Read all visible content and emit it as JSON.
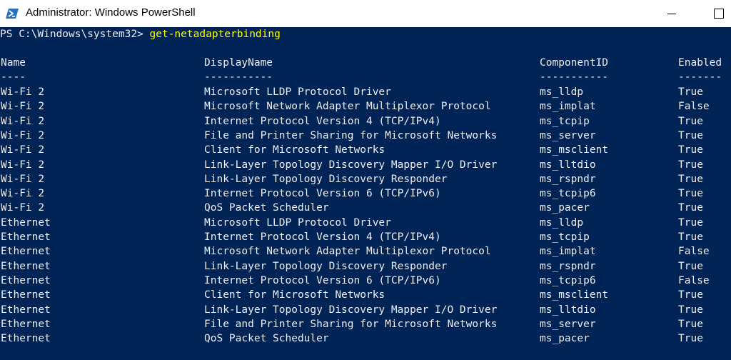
{
  "window": {
    "title": "Administrator: Windows PowerShell"
  },
  "console": {
    "prompt": "PS C:\\Windows\\system32> ",
    "command": "get-netadapterbinding",
    "headers": {
      "name": "Name",
      "display_name": "DisplayName",
      "component_id": "ComponentID",
      "enabled": "Enabled"
    },
    "underlines": {
      "name": "----",
      "display_name": "-----------",
      "component_id": "-----------",
      "enabled": "-------"
    },
    "rows": [
      {
        "name": "Wi-Fi 2",
        "display_name": "Microsoft LLDP Protocol Driver",
        "component_id": "ms_lldp",
        "enabled": "True"
      },
      {
        "name": "Wi-Fi 2",
        "display_name": "Microsoft Network Adapter Multiplexor Protocol",
        "component_id": "ms_implat",
        "enabled": "False"
      },
      {
        "name": "Wi-Fi 2",
        "display_name": "Internet Protocol Version 4 (TCP/IPv4)",
        "component_id": "ms_tcpip",
        "enabled": "True"
      },
      {
        "name": "Wi-Fi 2",
        "display_name": "File and Printer Sharing for Microsoft Networks",
        "component_id": "ms_server",
        "enabled": "True"
      },
      {
        "name": "Wi-Fi 2",
        "display_name": "Client for Microsoft Networks",
        "component_id": "ms_msclient",
        "enabled": "True"
      },
      {
        "name": "Wi-Fi 2",
        "display_name": "Link-Layer Topology Discovery Mapper I/O Driver",
        "component_id": "ms_lltdio",
        "enabled": "True"
      },
      {
        "name": "Wi-Fi 2",
        "display_name": "Link-Layer Topology Discovery Responder",
        "component_id": "ms_rspndr",
        "enabled": "True"
      },
      {
        "name": "Wi-Fi 2",
        "display_name": "Internet Protocol Version 6 (TCP/IPv6)",
        "component_id": "ms_tcpip6",
        "enabled": "True"
      },
      {
        "name": "Wi-Fi 2",
        "display_name": "QoS Packet Scheduler",
        "component_id": "ms_pacer",
        "enabled": "True"
      },
      {
        "name": "Ethernet",
        "display_name": "Microsoft LLDP Protocol Driver",
        "component_id": "ms_lldp",
        "enabled": "True"
      },
      {
        "name": "Ethernet",
        "display_name": "Internet Protocol Version 4 (TCP/IPv4)",
        "component_id": "ms_tcpip",
        "enabled": "True"
      },
      {
        "name": "Ethernet",
        "display_name": "Microsoft Network Adapter Multiplexor Protocol",
        "component_id": "ms_implat",
        "enabled": "False"
      },
      {
        "name": "Ethernet",
        "display_name": "Link-Layer Topology Discovery Responder",
        "component_id": "ms_rspndr",
        "enabled": "True"
      },
      {
        "name": "Ethernet",
        "display_name": "Internet Protocol Version 6 (TCP/IPv6)",
        "component_id": "ms_tcpip6",
        "enabled": "False"
      },
      {
        "name": "Ethernet",
        "display_name": "Client for Microsoft Networks",
        "component_id": "ms_msclient",
        "enabled": "True"
      },
      {
        "name": "Ethernet",
        "display_name": "Link-Layer Topology Discovery Mapper I/O Driver",
        "component_id": "ms_lltdio",
        "enabled": "True"
      },
      {
        "name": "Ethernet",
        "display_name": "File and Printer Sharing for Microsoft Networks",
        "component_id": "ms_server",
        "enabled": "True"
      },
      {
        "name": "Ethernet",
        "display_name": "QoS Packet Scheduler",
        "component_id": "ms_pacer",
        "enabled": "True"
      }
    ]
  },
  "colors": {
    "console_background": "#012456",
    "console_text": "#eeedf0",
    "command_text": "#ffff00",
    "titlebar_background": "#ffffff"
  },
  "icons": {
    "app": "powershell-icon",
    "minimize": "minimize-icon",
    "maximize": "maximize-icon"
  }
}
